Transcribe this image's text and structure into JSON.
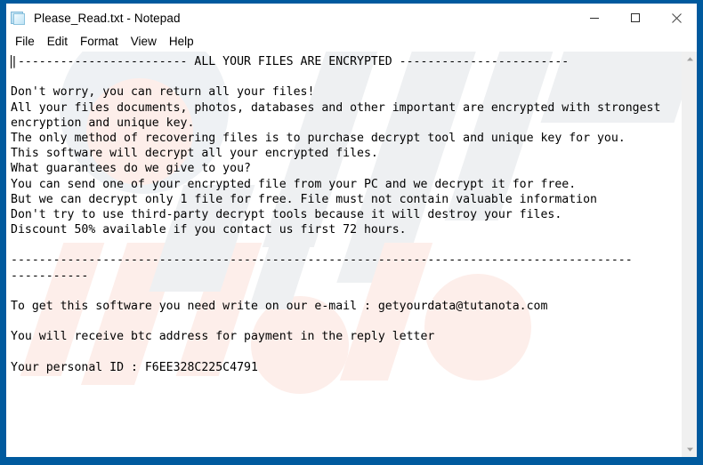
{
  "window": {
    "title": "Please_Read.txt - Notepad",
    "app_icon": "notepad-document-icon",
    "border_color": "#005a9e",
    "background": "#ffffff"
  },
  "window_controls": {
    "minimize_label": "Minimize",
    "maximize_label": "Maximize",
    "close_label": "Close"
  },
  "menu_bar": {
    "items": [
      {
        "label": "File"
      },
      {
        "label": "Edit"
      },
      {
        "label": "Format"
      },
      {
        "label": "View"
      },
      {
        "label": "Help"
      }
    ]
  },
  "document": {
    "filename": "Please_Read.txt",
    "personal_id": "F6EE328C225C4791",
    "contact_email": "getyourdata@tutanota.com",
    "discount_percent": "50%",
    "discount_hours": "72",
    "free_decrypt_files": "1",
    "lines": [
      "|------------------------ ALL YOUR FILES ARE ENCRYPTED ------------------------",
      "",
      "Don't worry, you can return all your files!",
      "All your files documents, photos, databases and other important are encrypted with strongest",
      "encryption and unique key.",
      "The only method of recovering files is to purchase decrypt tool and unique key for you.",
      "This software will decrypt all your encrypted files.",
      "What guarantees do we give to you?",
      "You can send one of your encrypted file from your PC and we decrypt it for free.",
      "But we can decrypt only 1 file for free. File must not contain valuable information",
      "Don't try to use third-party decrypt tools because it will destroy your files.",
      "Discount 50% available if you contact us first 72 hours.",
      "",
      "----------------------------------------------------------------------------------------",
      "-----------",
      "",
      "To get this software you need write on our e-mail : getyourdata@tutanota.com",
      "",
      "You will receive btc address for payment in the reply letter",
      "",
      "Your personal ID : F6EE328C225C4791"
    ]
  },
  "scrollbar": {
    "up_arrow_label": "Scroll up",
    "down_arrow_label": "Scroll down"
  }
}
